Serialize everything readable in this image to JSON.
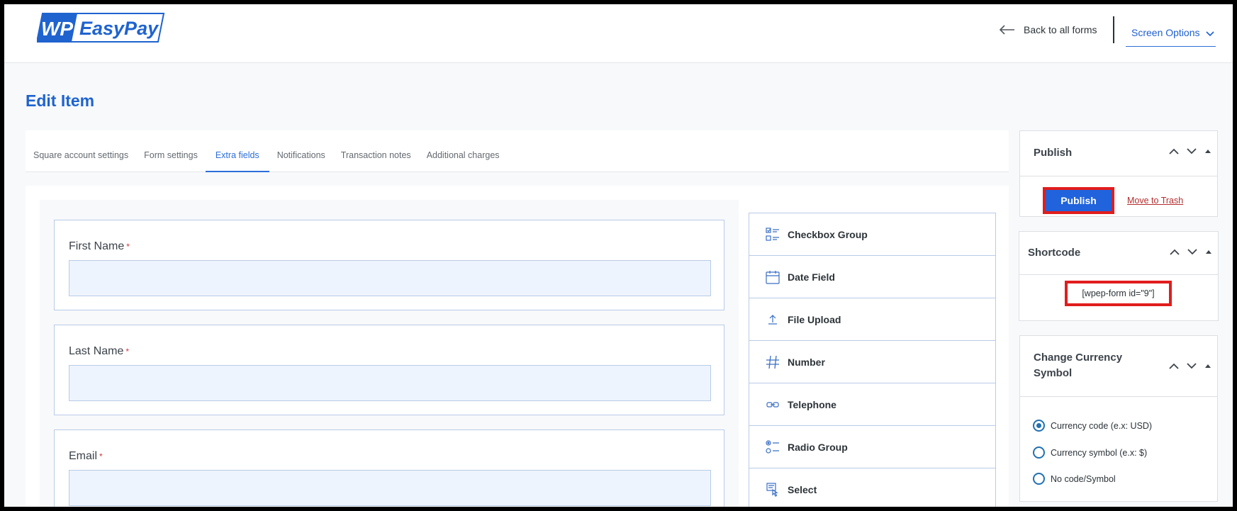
{
  "header": {
    "logo_text": "WP EasyPay",
    "back_link": "Back to all forms",
    "screen_options": "Screen Options"
  },
  "page_title": "Edit Item",
  "tabs": [
    {
      "label": "Square account settings",
      "active": false
    },
    {
      "label": "Form settings",
      "active": false
    },
    {
      "label": "Extra fields",
      "active": true
    },
    {
      "label": "Notifications",
      "active": false
    },
    {
      "label": "Transaction notes",
      "active": false
    },
    {
      "label": "Additional charges",
      "active": false
    }
  ],
  "form_fields": [
    {
      "label": "First Name",
      "required_mark": "*",
      "value": ""
    },
    {
      "label": "Last Name",
      "required_mark": "*",
      "value": ""
    },
    {
      "label": "Email",
      "required_mark": "*",
      "value": ""
    }
  ],
  "palette": [
    {
      "label": "Checkbox Group",
      "icon": "checkbox-group-icon"
    },
    {
      "label": "Date Field",
      "icon": "calendar-icon"
    },
    {
      "label": "File Upload",
      "icon": "upload-icon"
    },
    {
      "label": "Number",
      "icon": "hash-icon"
    },
    {
      "label": "Telephone",
      "icon": "link-icon"
    },
    {
      "label": "Radio Group",
      "icon": "radio-group-icon"
    },
    {
      "label": "Select",
      "icon": "select-icon"
    }
  ],
  "publish_box": {
    "title": "Publish",
    "publish_button": "Publish",
    "trash_link": "Move to Trash"
  },
  "shortcode_box": {
    "title": "Shortcode",
    "code": "[wpep-form id=\"9\"]"
  },
  "currency_box": {
    "title_line1": "Change Currency",
    "title_line2": "Symbol",
    "options": [
      {
        "label": "Currency code (e.x: USD)",
        "selected": true
      },
      {
        "label": "Currency symbol (e.x: $)",
        "selected": false
      },
      {
        "label": "No code/Symbol",
        "selected": false
      }
    ]
  },
  "colors": {
    "accent": "#1f63cf",
    "publish_button": "#2063dc",
    "highlight_border": "#e11d1d",
    "trash_link": "#b32d2e"
  }
}
